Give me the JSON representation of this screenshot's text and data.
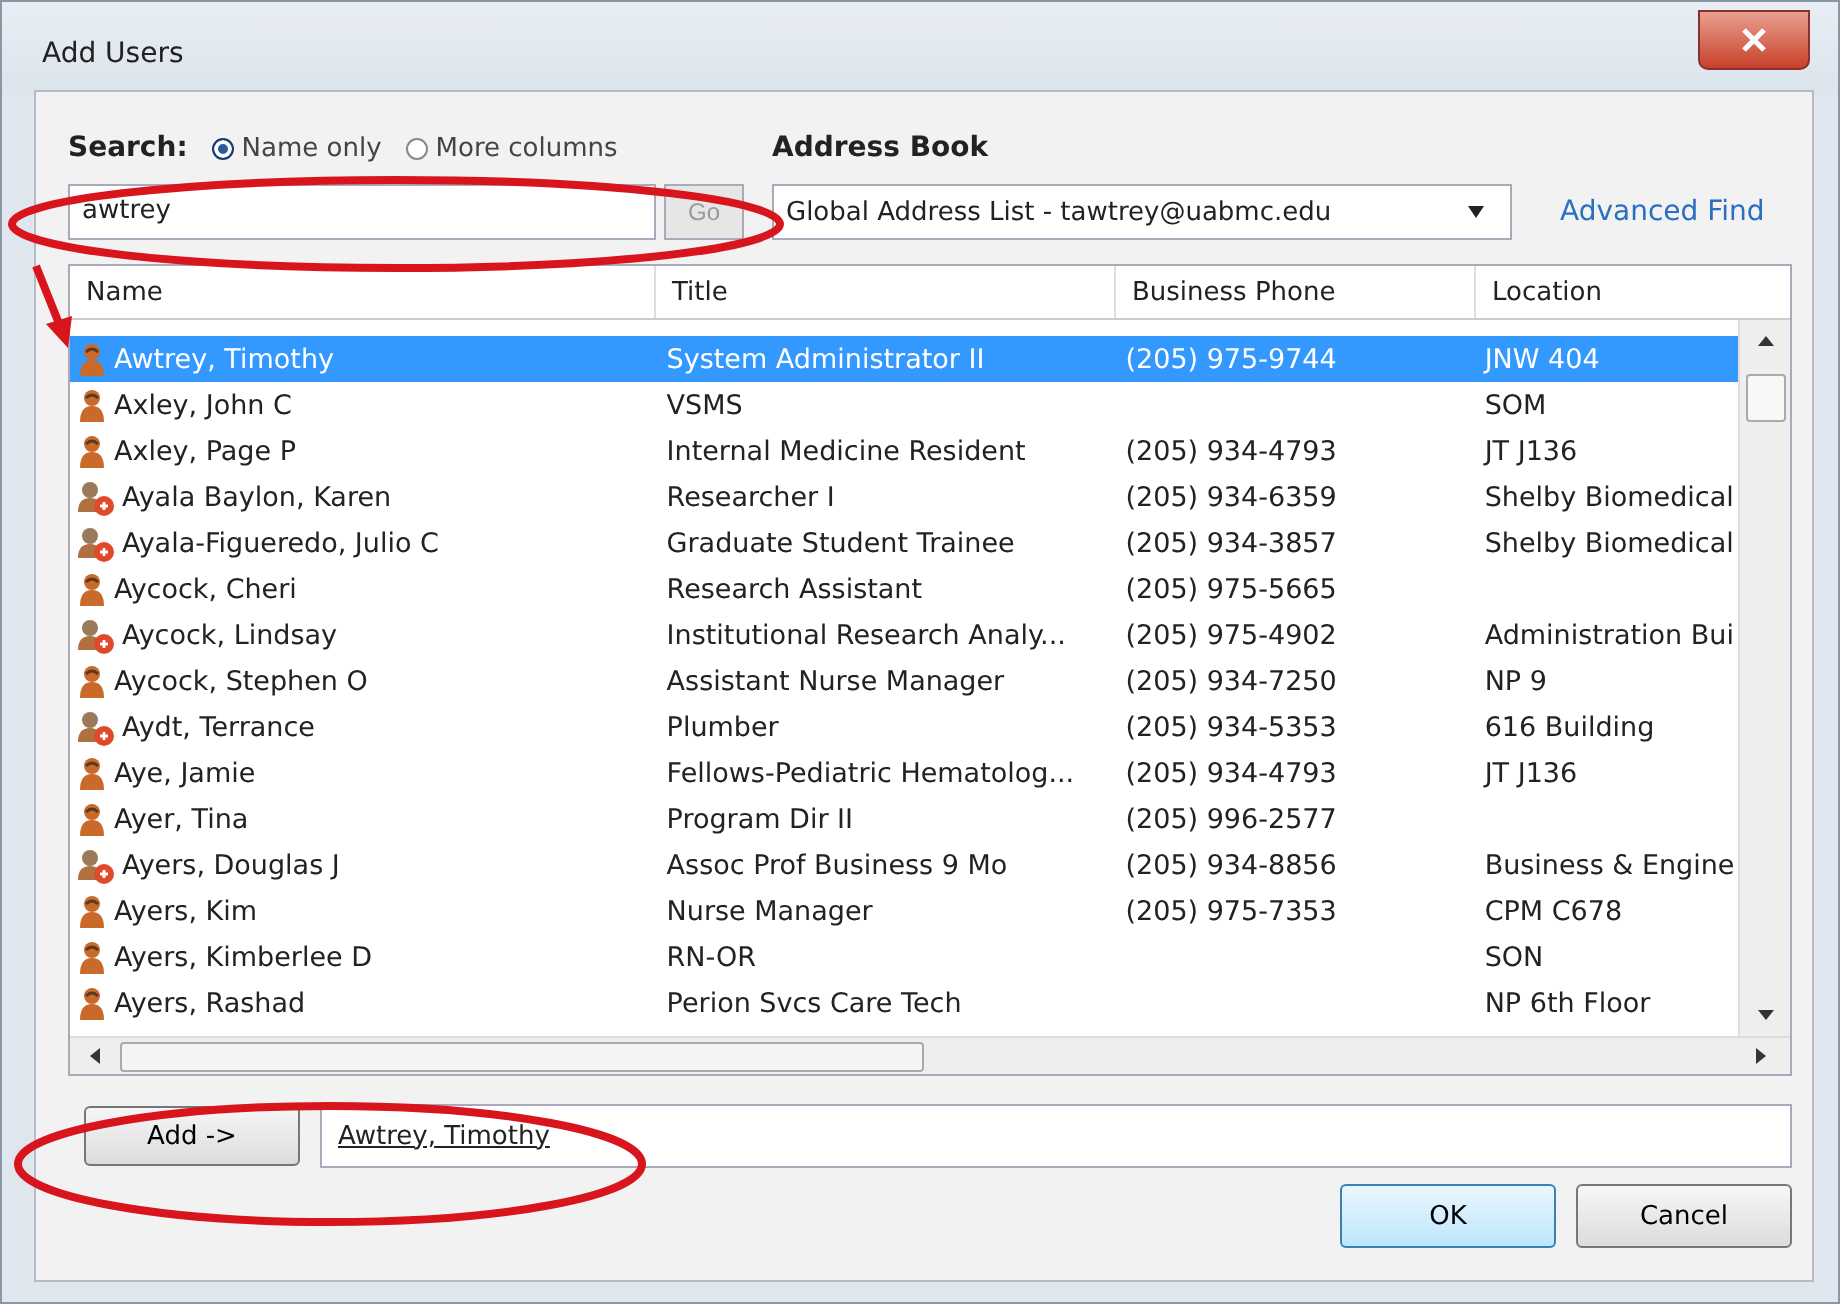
{
  "window": {
    "title": "Add Users"
  },
  "search": {
    "label": "Search:",
    "options": [
      {
        "label": "Name only",
        "selected": true
      },
      {
        "label": "More columns",
        "selected": false
      }
    ],
    "value": "awtrey",
    "go_button": "Go"
  },
  "address_book": {
    "label": "Address Book",
    "value": "Global Address List - tawtrey@uabmc.edu"
  },
  "advanced_find": "Advanced Find",
  "table": {
    "columns": [
      "Name",
      "Title",
      "Business Phone",
      "Location"
    ],
    "rows": [
      {
        "kind": "user",
        "selected": true,
        "name": "Awtrey, Timothy",
        "title": "System Administrator II",
        "phone": "(205) 975-9744",
        "location": "JNW 404"
      },
      {
        "kind": "user",
        "selected": false,
        "name": "Axley, John C",
        "title": "VSMS",
        "location": "SOM"
      },
      {
        "kind": "user",
        "selected": false,
        "name": "Axley, Page P",
        "title": "Internal Medicine Resident",
        "phone": "(205) 934-4793",
        "location": "JT J136"
      },
      {
        "kind": "contact",
        "selected": false,
        "name": "Ayala Baylon, Karen",
        "title": "Researcher I",
        "phone": "(205) 934-6359",
        "location": "Shelby Biomedical"
      },
      {
        "kind": "contact",
        "selected": false,
        "name": "Ayala-Figueredo, Julio C",
        "title": "Graduate Student Trainee",
        "phone": "(205) 934-3857",
        "location": "Shelby Biomedical"
      },
      {
        "kind": "user",
        "selected": false,
        "name": "Aycock, Cheri",
        "title": "Research Assistant",
        "phone": "(205) 975-5665"
      },
      {
        "kind": "contact",
        "selected": false,
        "name": "Aycock, Lindsay",
        "title": "Institutional Research Analy...",
        "phone": "(205) 975-4902",
        "location": "Administration Bui"
      },
      {
        "kind": "user",
        "selected": false,
        "name": "Aycock, Stephen O",
        "title": "Assistant Nurse Manager",
        "phone": "(205) 934-7250",
        "location": "NP 9"
      },
      {
        "kind": "contact",
        "selected": false,
        "name": "Aydt, Terrance",
        "title": "Plumber",
        "phone": "(205) 934-5353",
        "location": "616 Building"
      },
      {
        "kind": "user",
        "selected": false,
        "name": "Aye, Jamie",
        "title": "Fellows-Pediatric Hematolog...",
        "phone": "(205) 934-4793",
        "location": "JT J136"
      },
      {
        "kind": "user",
        "selected": false,
        "name": "Ayer, Tina",
        "title": "Program Dir II",
        "phone": "(205) 996-2577"
      },
      {
        "kind": "contact",
        "selected": false,
        "name": "Ayers, Douglas J",
        "title": "Assoc Prof Business 9 Mo",
        "phone": "(205) 934-8856",
        "location": "Business & Engine"
      },
      {
        "kind": "user",
        "selected": false,
        "name": "Ayers, Kim",
        "title": "Nurse Manager",
        "phone": "(205) 975-7353",
        "location": "CPM C678"
      },
      {
        "kind": "user",
        "selected": false,
        "name": "Ayers, Kimberlee D",
        "title": "RN-OR",
        "location": "SON"
      },
      {
        "kind": "user",
        "selected": false,
        "name": "Ayers, Rashad",
        "title": "Perion Svcs Care Tech",
        "location": "NP 6th Floor"
      }
    ]
  },
  "add_button": "Add ->",
  "recipients": "Awtrey, Timothy",
  "buttons": [
    "OK",
    "Cancel"
  ]
}
